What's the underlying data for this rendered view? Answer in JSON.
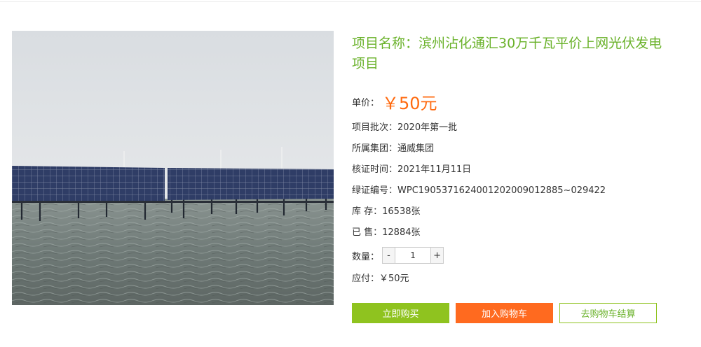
{
  "product": {
    "title": "项目名称：滨州沾化通汇30万千瓦平价上网光伏发电项目",
    "image_alt": "solar-panels-over-water-photo"
  },
  "price": {
    "label": "单价：",
    "value": "￥50元"
  },
  "details": [
    {
      "label": "项目批次：",
      "value": "2020年第一批"
    },
    {
      "label": "所属集团：",
      "value": "通威集团"
    },
    {
      "label": "核证时间：",
      "value": "2021年11月11日"
    },
    {
      "label": "绿证编号：",
      "value": "WPC190537162400120200901288​5~029422"
    },
    {
      "label": "库 存：",
      "value": "16538张"
    },
    {
      "label": "已 售：",
      "value": "12884张"
    }
  ],
  "quantity": {
    "label": "数量：",
    "minus": "-",
    "value": "1",
    "plus": "+"
  },
  "payable": {
    "label": "应付：",
    "value": "￥50元"
  },
  "buttons": {
    "buy_now": "立即购买",
    "add_cart": "加入购物车",
    "checkout": "去购物车结算"
  },
  "colors": {
    "title_green": "#6ab22a",
    "price_orange": "#ff6a0f",
    "buy_green": "#8fc31f",
    "cart_orange": "#ff6a1f"
  }
}
